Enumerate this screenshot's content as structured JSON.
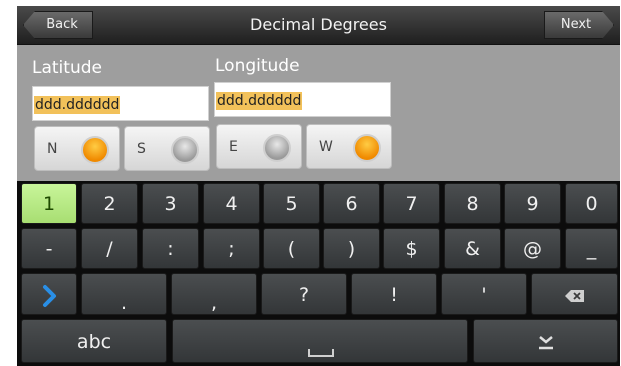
{
  "header": {
    "back_label": "Back",
    "title": "Decimal Degrees",
    "next_label": "Next"
  },
  "latitude": {
    "label": "Latitude",
    "value": "ddd.dddddd",
    "dir1": "N",
    "dir2": "S",
    "selected": "N"
  },
  "longitude": {
    "label": "Longitude",
    "value": "ddd.dddddd",
    "dir1": "E",
    "dir2": "W",
    "selected": "W"
  },
  "keyboard": {
    "row_numbers": [
      "1",
      "2",
      "3",
      "4",
      "5",
      "6",
      "7",
      "8",
      "9",
      "0"
    ],
    "row_symbols": [
      "-",
      "/",
      ":",
      ";",
      "(",
      ")",
      "$",
      "&",
      "@",
      "_"
    ],
    "row_punct": [
      ".",
      ",",
      "?",
      "!",
      "'"
    ],
    "abc_label": "abc",
    "highlighted_key": "1",
    "icons": {
      "next_field": "chevron-right-icon",
      "backspace": "backspace-icon",
      "space": "space-bar-icon",
      "hide": "hide-keyboard-icon"
    },
    "colors": {
      "highlight": "#b6e884",
      "accent_blue": "#2a8fe6",
      "radio_on": "#f39a10"
    }
  }
}
